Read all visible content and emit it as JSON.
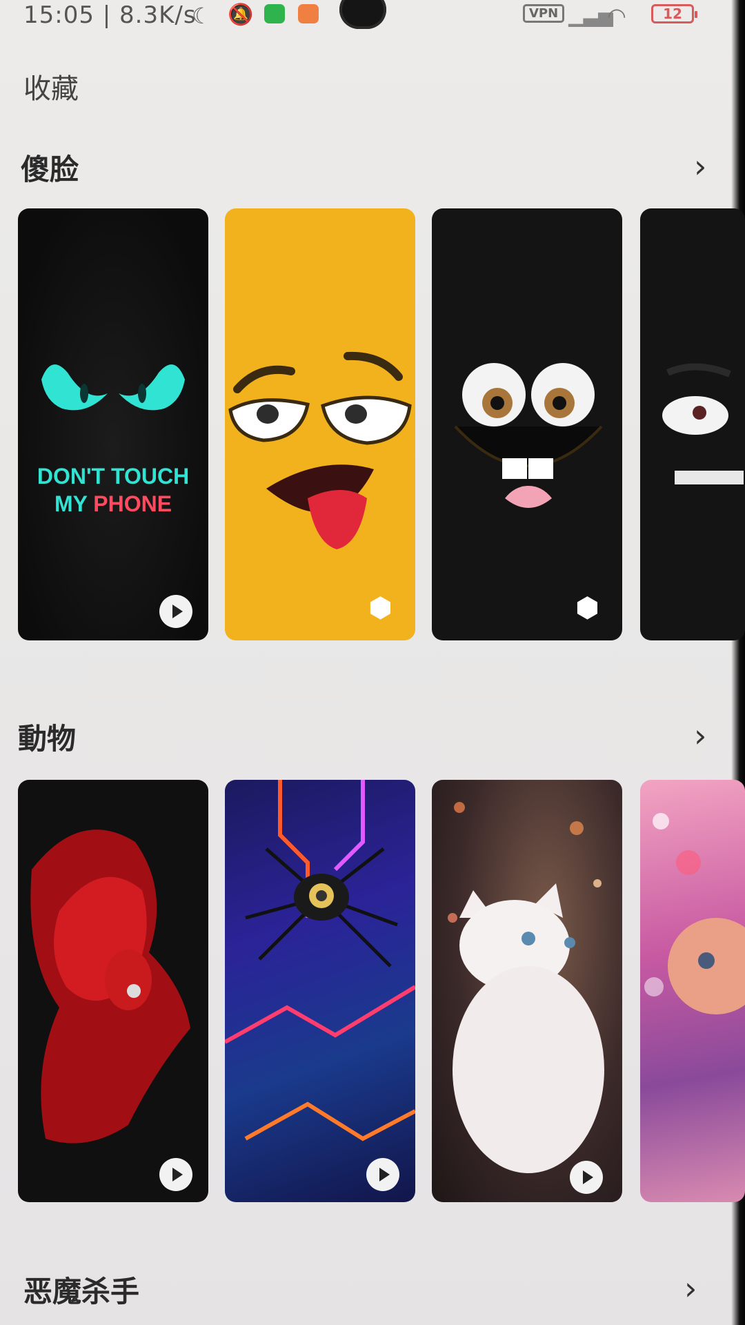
{
  "status_bar": {
    "text": "15:05 | 8.3K/s",
    "moon_icon": "☾",
    "bell_icon": "🔕",
    "vpn": "VPN",
    "signal_icon": "▁▃▅",
    "wifi_icon": "◠",
    "battery": "12"
  },
  "page": {
    "title": "收藏"
  },
  "sections": [
    {
      "title": "傻脸",
      "chevron": "›",
      "cards": [
        {
          "text_line1": "DON'T TOUCH",
          "text_line2_a": "MY ",
          "text_line2_b": "PHONE",
          "badge": "play"
        },
        {
          "badge": "3d"
        },
        {
          "badge": "3d"
        },
        {
          "badge": "none"
        }
      ]
    },
    {
      "title": "動物",
      "chevron": "›",
      "cards": [
        {
          "badge": "play"
        },
        {
          "badge": "play"
        },
        {
          "badge": "play"
        },
        {
          "badge": "none"
        }
      ]
    },
    {
      "title": "恶魔杀手",
      "chevron": "›"
    }
  ],
  "icons": {
    "cube": "⬢"
  },
  "colors": {
    "neon_cyan": "#31e3d2",
    "neon_red": "#ff4a5f",
    "emoji_yellow": "#f2b21d",
    "dark_card": "#141414"
  }
}
